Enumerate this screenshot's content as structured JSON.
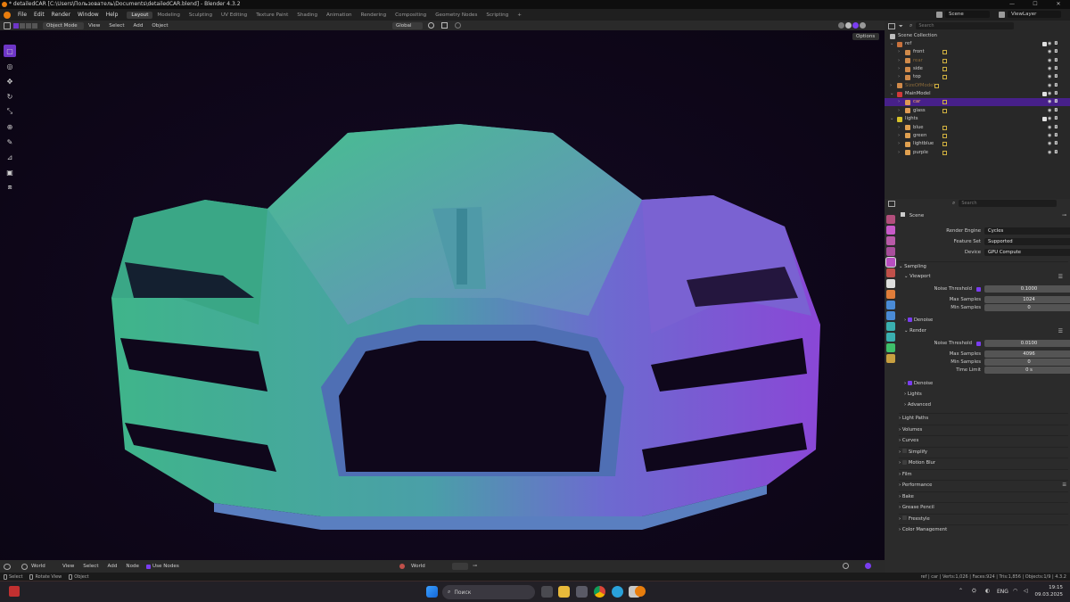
{
  "window": {
    "title": "* detailedCAR [C:\\Users\\Пользователь\\Documents\\detailedCAR.blend] - Blender 4.3.2"
  },
  "topbar": {
    "menus": [
      "File",
      "Edit",
      "Render",
      "Window",
      "Help"
    ],
    "workspaces": [
      "Layout",
      "Modeling",
      "Sculpting",
      "UV Editing",
      "Texture Paint",
      "Shading",
      "Animation",
      "Rendering",
      "Compositing",
      "Geometry Nodes",
      "Scripting"
    ],
    "active_workspace": "Layout",
    "add_tab": "+",
    "scene": "Scene",
    "view_layer": "ViewLayer"
  },
  "viewport_header": {
    "mode": "Object Mode",
    "menus": [
      "View",
      "Select",
      "Add",
      "Object"
    ],
    "orientation": "Global",
    "options": "Options"
  },
  "outliner": {
    "search_placeholder": "Search",
    "root": "Scene Collection",
    "rows": [
      {
        "label": "ref",
        "type": "collection",
        "color": "#c8723d",
        "depth": 0
      },
      {
        "label": "front",
        "type": "empty",
        "color": "#d08a4a",
        "depth": 1
      },
      {
        "label": "rear",
        "type": "empty",
        "color": "#d08a4a",
        "depth": 1,
        "dim": true
      },
      {
        "label": "side",
        "type": "empty",
        "color": "#d08a4a",
        "depth": 1
      },
      {
        "label": "top",
        "type": "empty",
        "color": "#d08a4a",
        "depth": 1
      },
      {
        "label": "SizeOfModel",
        "type": "object",
        "color": "#d08a4a",
        "depth": 0,
        "dim": true
      },
      {
        "label": "MainModel",
        "type": "collection",
        "color": "#d23a3a",
        "depth": 0
      },
      {
        "label": "car",
        "type": "mesh",
        "color": "#e09a54",
        "depth": 1,
        "selected": true
      },
      {
        "label": "glass",
        "type": "mesh",
        "color": "#e09a54",
        "depth": 1
      },
      {
        "label": "lights",
        "type": "collection",
        "color": "#d6c22a",
        "depth": 0
      },
      {
        "label": "blue",
        "type": "light",
        "color": "#e0a050",
        "depth": 1
      },
      {
        "label": "green",
        "type": "light",
        "color": "#e0a050",
        "depth": 1
      },
      {
        "label": "lightblue",
        "type": "light",
        "color": "#e0a050",
        "depth": 1
      },
      {
        "label": "purple",
        "type": "light",
        "color": "#e0a050",
        "depth": 1
      }
    ]
  },
  "properties": {
    "search_placeholder": "Search",
    "context": "Scene",
    "render_engine_label": "Render Engine",
    "render_engine": "Cycles",
    "feature_set_label": "Feature Set",
    "feature_set": "Supported",
    "device_label": "Device",
    "device": "GPU Compute",
    "sampling": "Sampling",
    "viewport": "Viewport",
    "noise_threshold_label": "Noise Threshold",
    "viewport_noise_threshold": "0.1000",
    "max_samples_label": "Max Samples",
    "viewport_max_samples": "1024",
    "min_samples_label": "Min Samples",
    "viewport_min_samples": "0",
    "denoise": "Denoise",
    "render": "Render",
    "render_noise_threshold": "0.0100",
    "render_max_samples": "4096",
    "render_min_samples": "0",
    "time_limit_label": "Time Limit",
    "render_time_limit": "0 s",
    "denoise2": "Denoise",
    "lights": "Lights",
    "advanced": "Advanced",
    "panels": [
      "Light Paths",
      "Volumes",
      "Curves",
      "Simplify",
      "Motion Blur",
      "Film",
      "Performance",
      "Bake",
      "Grease Pencil",
      "Freestyle",
      "Color Management"
    ]
  },
  "node_header": {
    "world": "World",
    "menus": [
      "View",
      "Select",
      "Add",
      "Node"
    ],
    "use_nodes": "Use Nodes",
    "world_name": "World"
  },
  "statusbar": {
    "select": "Select",
    "rotate_view": "Rotate View",
    "object": "Object",
    "stats": "ref | car | Verts:1,026 | Faces:924 | Tris:1,856 | Objects:1/9 | 4.3.2"
  },
  "taskbar": {
    "search": "Поиск",
    "language": "ENG",
    "time": "19:15",
    "date": "09.03.2025"
  },
  "colors": {
    "selection": "#6e36c7",
    "outliner_selected_row": "#47208a",
    "car_teal": "#3fb58a",
    "car_purple": "#8a47d6"
  }
}
